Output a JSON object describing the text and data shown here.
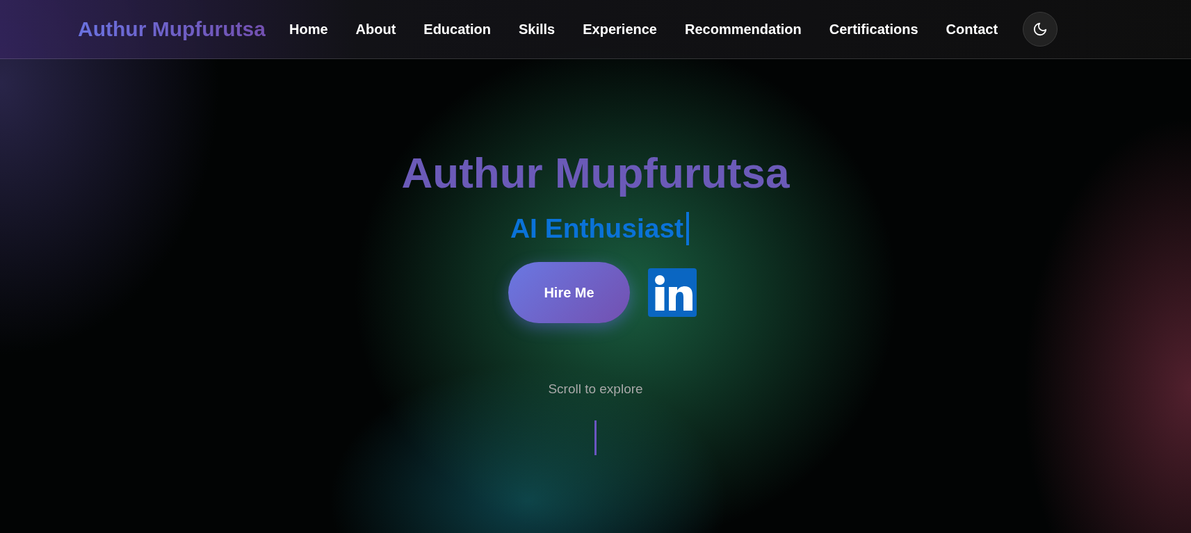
{
  "navbar": {
    "brand": "Authur Mupfurutsa",
    "links": [
      "Home",
      "About",
      "Education",
      "Skills",
      "Experience",
      "Recommendation",
      "Certifications",
      "Contact"
    ]
  },
  "hero": {
    "name": "Authur Mupfurutsa",
    "subtitle": "AI Enthusiast",
    "button": "Hire Me",
    "scroll_hint": "Scroll to explore"
  }
}
